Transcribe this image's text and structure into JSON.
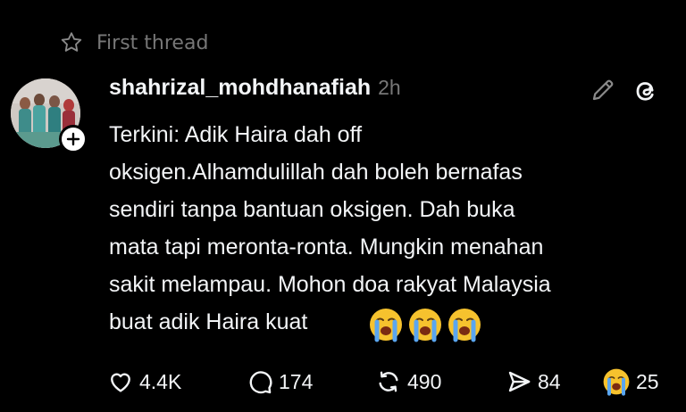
{
  "post": {
    "first_thread_label": "First thread",
    "username": "shahrizal_mohdhanafiah",
    "timestamp": "2h",
    "text": "Terkini: Adik Haira dah off\noksigen.Alhamdulillah dah boleh bernafas\nsendiri tanpa bantuan oksigen. Dah buka\nmata tapi meronta-ronta. Mungkin menahan\nsakit melampau. Mohon doa rakyat Malaysia\nbuat adik Haira kuat",
    "emojis": [
      "loudly-crying-face",
      "loudly-crying-face",
      "loudly-crying-face"
    ]
  },
  "actions": {
    "likes": "4.4K",
    "replies": "174",
    "reposts": "490",
    "shares": "84",
    "reactions": "25"
  },
  "icons": {
    "star": "star-outline-icon",
    "follow": "plus-icon",
    "edit": "pencil-icon",
    "brand": "threads-logo-icon",
    "like": "heart-outline-icon",
    "reply": "speech-bubble-icon",
    "repost": "repost-arrows-icon",
    "share": "send-icon",
    "reaction": "loudly-crying-face-icon"
  },
  "colors": {
    "background": "#000000",
    "text": "#f3f5f7",
    "muted": "#777777",
    "emoji_yellow": "#f6c22e",
    "emoji_tears": "#5aa6f0"
  }
}
